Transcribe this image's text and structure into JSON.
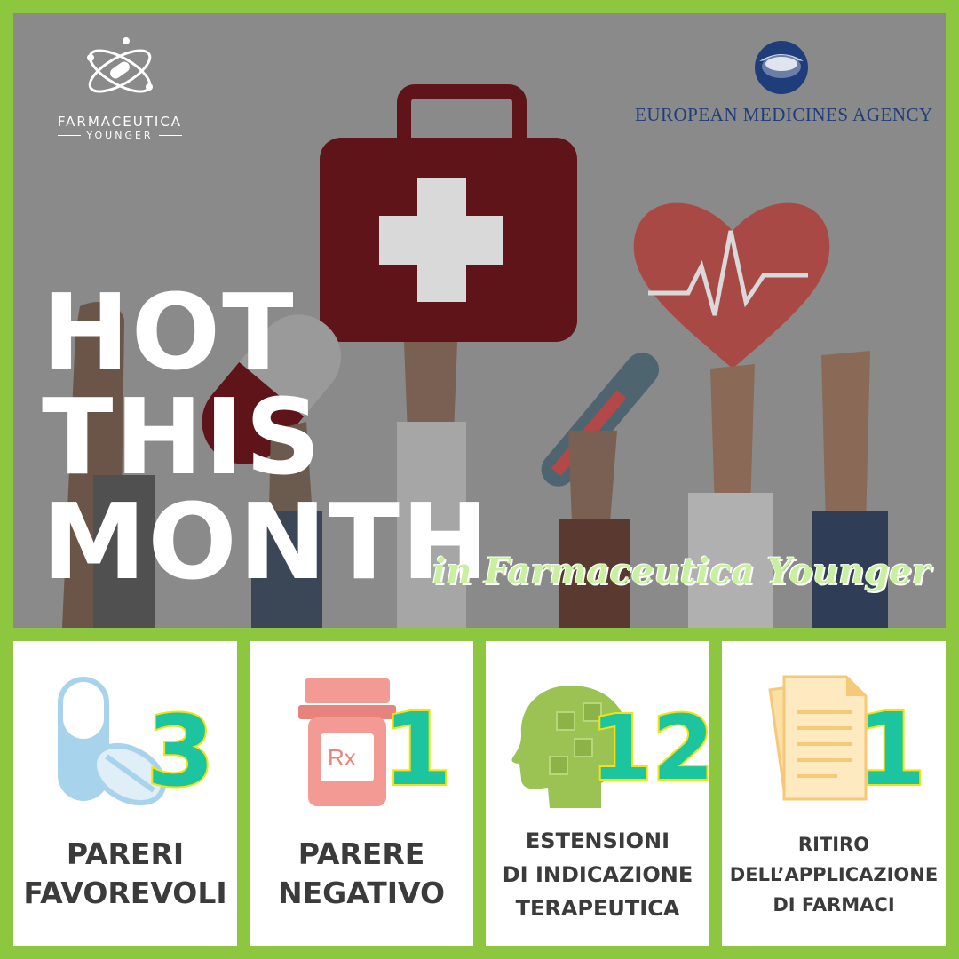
{
  "brand": {
    "name": "FARMACEUTICA",
    "subname": "YOUNGER",
    "icon": "atom-pill-icon"
  },
  "agency": {
    "name": "EUROPEAN MEDICINES AGENCY",
    "icon": "ema-globe-icon"
  },
  "headline": {
    "line1": "HOT",
    "line2": "THIS",
    "line3": "MONTH",
    "tagline": "in Farmaceutica Younger"
  },
  "colors": {
    "frame": "#8dc63f",
    "number_fill": "#1cc5a0",
    "number_outline": "#f4e20a",
    "label": "#3b3b3b"
  },
  "stats": [
    {
      "icon": "capsule-pill-icon",
      "value": "3",
      "label_lines": [
        "PARERI",
        "FAVOREVOLI"
      ]
    },
    {
      "icon": "rx-bottle-icon",
      "value": "1",
      "label_lines": [
        "PARERE",
        "NEGATIVO"
      ]
    },
    {
      "icon": "puzzle-head-icon",
      "value": "12",
      "label_lines": [
        "ESTENSIONI",
        "DI INDICAZIONE",
        "TERAPEUTICA"
      ]
    },
    {
      "icon": "documents-icon",
      "value": "1",
      "label_lines": [
        "RITIRO",
        "DELL’APPLICAZIONE",
        "DI FARMACI"
      ]
    }
  ]
}
